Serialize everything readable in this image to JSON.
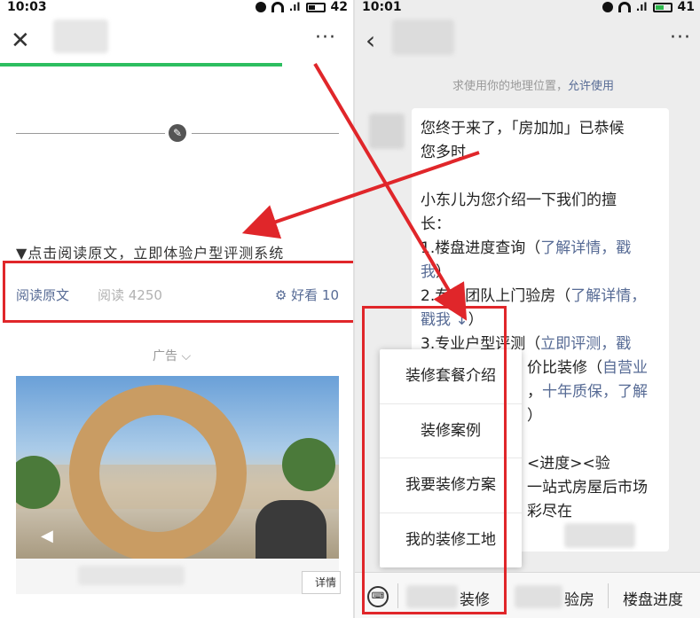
{
  "left": {
    "status_time": "10:03",
    "battery": "42",
    "intro_text": "▼点击阅读原文，立即体验户型评测系统",
    "read_original": "阅读原文",
    "read_count": "阅读 4250",
    "like": "好看 10",
    "ad_label": "广告",
    "ad_chevron": "⌵",
    "caption_button": "详情"
  },
  "right": {
    "status_time": "10:01",
    "battery": "41",
    "location_text": "求使用你的地理位置，",
    "location_allow": "允许使用",
    "message": {
      "l1": "您终于来了，「房加加」已恭候",
      "l2": "您多时",
      "l3": "小东儿为您介绍一下我们的擅",
      "l4": "长：",
      "l5a": "1.楼盘进度查询（",
      "l5b": "了解详情，戳",
      "l6a": "我",
      "l6b": "）",
      "l7a": "2.专业团队上门验房（",
      "l7b": "了解详情，",
      "l8a": "戳我 ↓",
      "l8b": "）",
      "l9a": "3.专业户型评测（",
      "l9b": "立即评测",
      "l9c": "，戳",
      "l10a": "价比装修（",
      "l10b": "自营业",
      "l11a": "，",
      "l11b": "十年质保，了解",
      "l12": "）",
      "l13": "<进度><验",
      "l14": "一站式房屋后市场",
      "l15": "彩尽在"
    },
    "menu_items": [
      "装修套餐介绍",
      "装修案例",
      "我要装修方案",
      "我的装修工地"
    ],
    "tabs": [
      "装修",
      "验房",
      "楼盘进度"
    ],
    "keyboard_icon": "⌨"
  },
  "colors": {
    "link": "#576b95",
    "highlight": "#e0262a",
    "progress": "#2dbe60"
  }
}
